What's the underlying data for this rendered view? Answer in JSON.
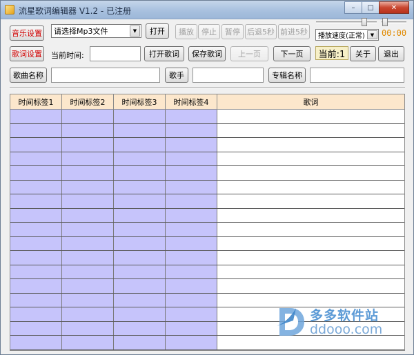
{
  "window": {
    "title": "流星歌词编辑器 V1.2 - 已注册",
    "controls": {
      "minimize": "–",
      "maximize": "□",
      "close": "✕"
    }
  },
  "toolbar": {
    "music_settings": "音乐设置",
    "file_select": "请选择Mp3文件",
    "open": "打开",
    "play": "播放",
    "stop": "停止",
    "pause": "暂停",
    "rewind": "后退5秒",
    "forward": "前进5秒",
    "speed_select": "播放速度(正常)",
    "time_readout": "00:00",
    "speed_slider_level": 0.8,
    "volume_slider_level": 0.15
  },
  "row2": {
    "lyric_settings": "歌词设置",
    "current_time_label": "当前时间:",
    "current_time_value": "",
    "open_lyrics": "打开歌词",
    "save_lyrics": "保存歌词",
    "prev_page": "上一页",
    "next_page": "下一页",
    "current_label": "当前:1",
    "about": "关于",
    "exit": "退出"
  },
  "row3": {
    "song_name": "歌曲名称",
    "singer": "歌手",
    "album_name": "专辑名称"
  },
  "grid": {
    "headers": [
      "时间标签1",
      "时间标签2",
      "时间标签3",
      "时间标签4",
      "歌词"
    ],
    "row_count": 17
  },
  "watermark": {
    "cn": "多多软件站",
    "en": "ddooo.com"
  },
  "colors": {
    "time_cell": "#c6c4fb",
    "header_bg": "#fce7cc",
    "accent_red": "#d10000",
    "time_orange": "#e08a00"
  }
}
